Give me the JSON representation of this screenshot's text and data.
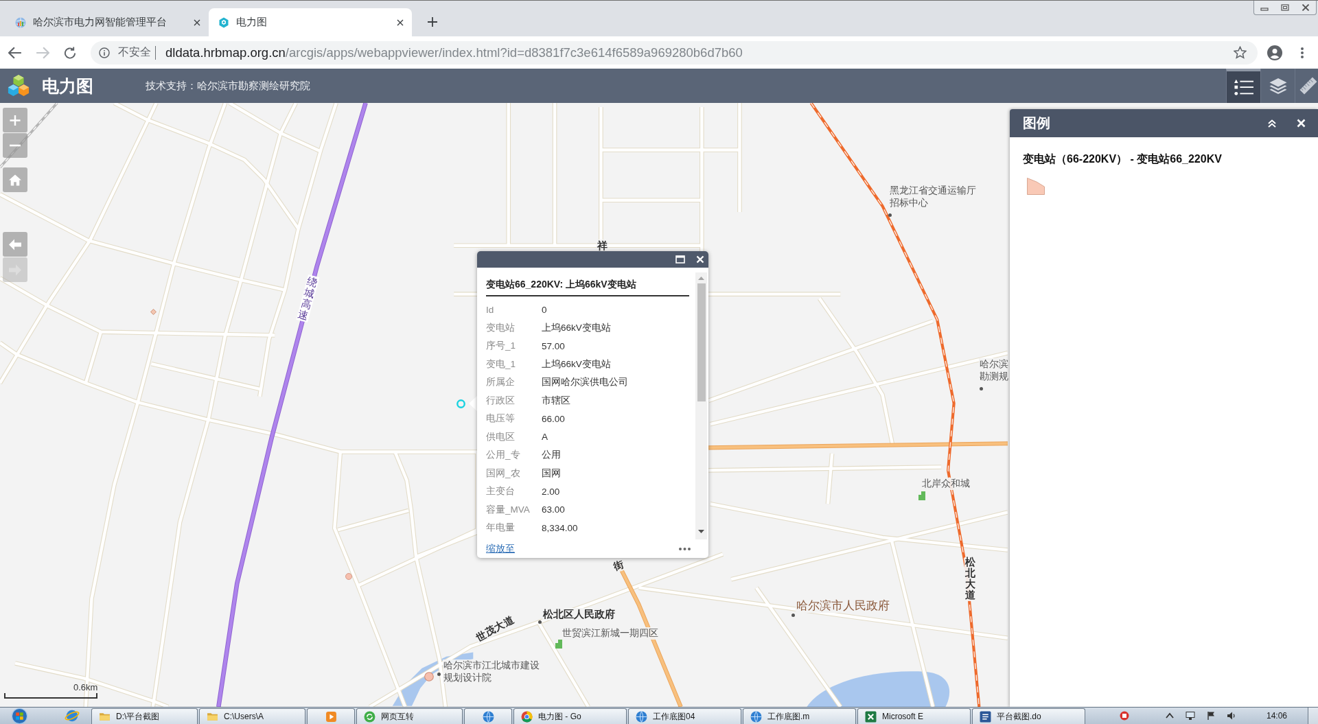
{
  "browser": {
    "tabs": [
      {
        "title": "哈尔滨市电力网智能管理平台",
        "selected": false
      },
      {
        "title": "电力图",
        "selected": true
      }
    ],
    "nav": [
      {
        "kind": "back",
        "disabled": false
      },
      {
        "kind": "forward",
        "disabled": true
      },
      {
        "kind": "reload",
        "disabled": false
      }
    ],
    "address": {
      "security": "不安全",
      "host": "dldata.hrbmap.org.cn",
      "path": "/arcgis/apps/webappviewer/index.html?id=d8381f7c3e614f6589a969280b6d7b60"
    }
  },
  "app_header": {
    "title": "电力图",
    "support": "技术支持：哈尔滨市勘察测绘研究院",
    "tools": [
      {
        "kind": "legend",
        "selected": true
      },
      {
        "kind": "layers",
        "selected": false
      },
      {
        "kind": "measure",
        "selected": false
      }
    ]
  },
  "map": {
    "controls": [
      {
        "kind": "zoom-in",
        "disabled": false
      },
      {
        "kind": "zoom-out",
        "disabled": false
      },
      {
        "kind": "home",
        "disabled": false
      },
      {
        "kind": "previous",
        "disabled": false
      },
      {
        "kind": "next",
        "disabled": true
      }
    ],
    "labels": [
      {
        "kind": "road",
        "text": "祥"
      },
      {
        "kind": "highway",
        "text": "绕城高速"
      },
      {
        "kind": "place",
        "text": "黑龙江省交通运输厅招标中心"
      },
      {
        "kind": "place",
        "text": "哈尔滨勘测规"
      },
      {
        "kind": "place",
        "text": "北岸众和城"
      },
      {
        "kind": "road",
        "text": "街"
      },
      {
        "kind": "road",
        "text": "松北大道"
      },
      {
        "kind": "government",
        "text": "哈尔滨市人民政府"
      },
      {
        "kind": "landmark",
        "text": "松北区人民政府"
      },
      {
        "kind": "road",
        "text": "世茂大道"
      },
      {
        "kind": "place",
        "text": "世贸滨江新城一期四区"
      },
      {
        "kind": "place",
        "text": "哈尔滨市江北城市建设规划设计院"
      }
    ],
    "scale": "0.6km"
  },
  "popup": {
    "title": "变电站66_220KV: 上坞66kV变电站",
    "fields": [
      {
        "name": "Id",
        "value": "0"
      },
      {
        "name": "变电站",
        "value": "上坞66kV变电站"
      },
      {
        "name": "序号_1",
        "value": "57.00"
      },
      {
        "name": "变电_1",
        "value": "上坞66kV变电站"
      },
      {
        "name": "所属企",
        "value": "国网哈尔滨供电公司"
      },
      {
        "name": "行政区",
        "value": "市辖区"
      },
      {
        "name": "电压等",
        "value": "66.00"
      },
      {
        "name": "供电区",
        "value": "A"
      },
      {
        "name": "公用_专",
        "value": "公用"
      },
      {
        "name": "国网_农",
        "value": "国网"
      },
      {
        "name": "主变台",
        "value": "2.00"
      },
      {
        "name": "容量_MVA",
        "value": "63.00"
      },
      {
        "name": "年电量",
        "value": "8,334.00"
      }
    ],
    "zoom_link": "缩放至"
  },
  "legend": {
    "title": "图例",
    "layer": "变电站（66-220KV） - 变电站66_220KV"
  },
  "taskbar": {
    "items": [
      {
        "kind": "folder",
        "label": "D:\\平台截图"
      },
      {
        "kind": "folder",
        "label": "C:\\Users\\A"
      },
      {
        "kind": "media"
      },
      {
        "kind": "sync",
        "label": "网页互转"
      },
      {
        "kind": "globe"
      },
      {
        "kind": "wheel",
        "label": "电力图 - Go"
      },
      {
        "kind": "globe",
        "label": "工作底图04"
      },
      {
        "kind": "globe",
        "label": "工作底图.m"
      },
      {
        "kind": "sheet",
        "label": "Microsoft E"
      },
      {
        "kind": "doc",
        "label": "平台截图.do"
      }
    ],
    "clock": "14:06"
  }
}
